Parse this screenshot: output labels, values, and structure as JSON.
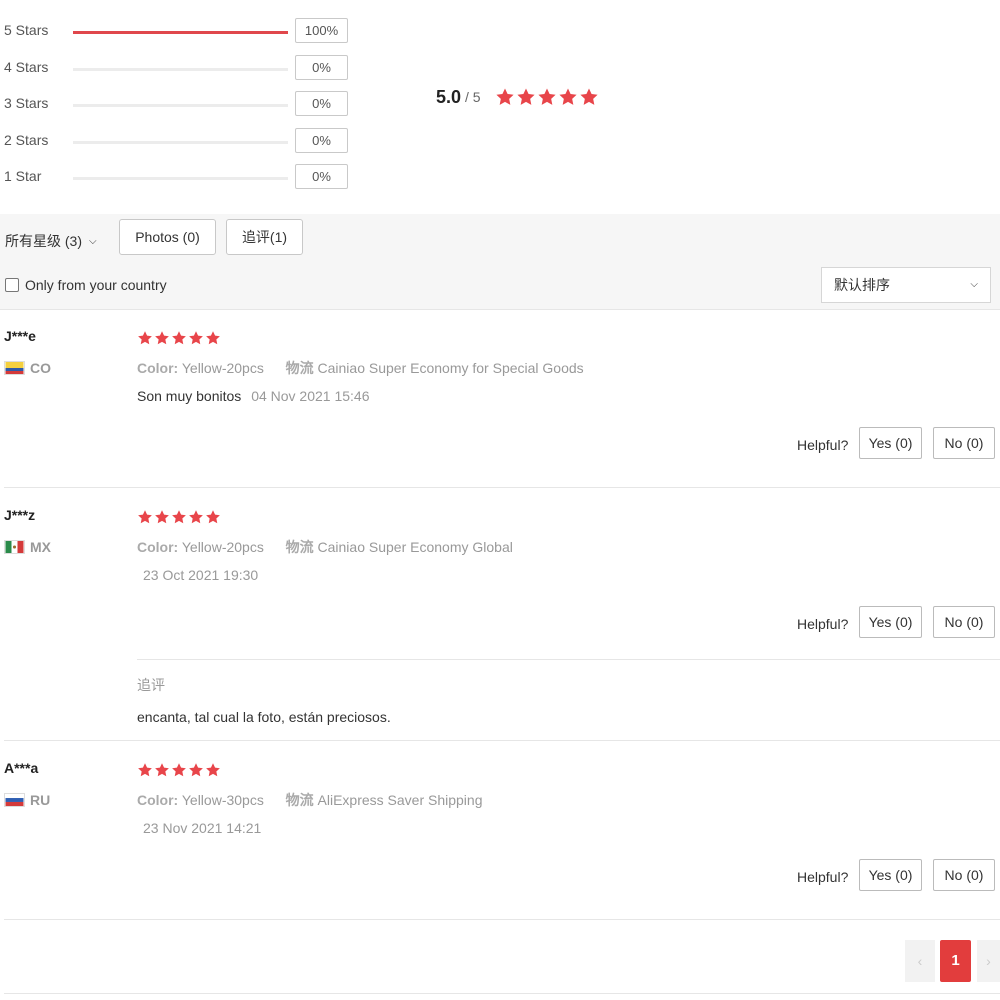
{
  "summary": {
    "distribution": [
      {
        "label": "5 Stars",
        "percent": "100%",
        "fill": 1.0
      },
      {
        "label": "4 Stars",
        "percent": "0%",
        "fill": 0
      },
      {
        "label": "3 Stars",
        "percent": "0%",
        "fill": 0
      },
      {
        "label": "2 Stars",
        "percent": "0%",
        "fill": 0
      },
      {
        "label": "1 Star",
        "percent": "0%",
        "fill": 0
      }
    ],
    "average": "5.0",
    "max": "/ 5",
    "stars": 5
  },
  "filters": {
    "star_filter": "所有星级 (3)",
    "photos_label": "Photos (0)",
    "additional_label": "追评(1)",
    "country_label": "Only from your country",
    "sort_label": "默认排序"
  },
  "reviews": [
    {
      "user": "J***e",
      "country": "CO",
      "stars": 5,
      "color_key": "Color:",
      "color_value": "Yellow-20pcs",
      "logistics_key": "物流",
      "logistics_value": "Cainiao Super Economy for Special Goods",
      "text": "Son muy bonitos",
      "date": "04 Nov 2021 15:46",
      "helpful": "Helpful?",
      "yes": "Yes (0)",
      "no": "No (0)"
    },
    {
      "user": "J***z",
      "country": "MX",
      "stars": 5,
      "color_key": "Color:",
      "color_value": "Yellow-20pcs",
      "logistics_key": "物流",
      "logistics_value": "Cainiao Super Economy Global",
      "text": "",
      "date": "23 Oct 2021 19:30",
      "helpful": "Helpful?",
      "yes": "Yes (0)",
      "no": "No (0)",
      "additional_title": "追评",
      "additional_text": "encanta, tal cual la foto, están preciosos."
    },
    {
      "user": "A***a",
      "country": "RU",
      "stars": 5,
      "color_key": "Color:",
      "color_value": "Yellow-30pcs",
      "logistics_key": "物流",
      "logistics_value": "AliExpress Saver Shipping",
      "text": "",
      "date": "23 Nov 2021 14:21",
      "helpful": "Helpful?",
      "yes": "Yes (0)",
      "no": "No (0)"
    }
  ],
  "pagination": {
    "prev": "‹",
    "current": "1",
    "next": "›"
  },
  "colors": {
    "accent": "#e23d3d",
    "star": "#e8454a",
    "bar_fill": "#e0474c"
  },
  "icons": {
    "star": "star-icon",
    "chevron": "chevron-down-icon",
    "checkbox": "checkbox-icon"
  }
}
